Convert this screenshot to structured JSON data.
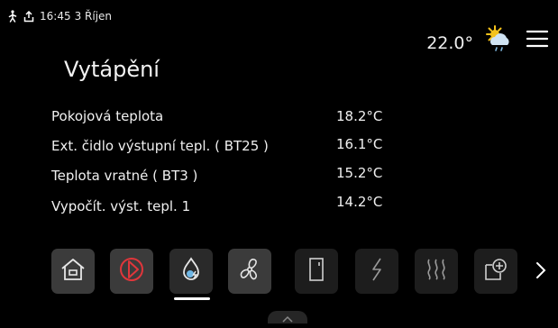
{
  "status": {
    "time": "16:45",
    "date": "3  Říjen"
  },
  "weather": {
    "temperature": "22.0°",
    "icon": "partly-sunny-rain-icon"
  },
  "page": {
    "title": "Vytápění"
  },
  "rows": [
    {
      "label": "Pokojová teplota",
      "value": "18.2°C"
    },
    {
      "label": "Ext. čidlo výstupní tepl. (  BT25 )",
      "value": "16.1°C"
    },
    {
      "label": "Teplota vratné ( BT3 )",
      "value": "15.2°C"
    },
    {
      "label": "Vypočít. výst. tepl. 1",
      "value": "14.2°C"
    }
  ],
  "nav": {
    "icons": [
      "home-icon",
      "play-icon",
      "water-drop-icon",
      "fan-icon",
      "door-icon",
      "lightning-icon",
      "heat-icon",
      "add-window-icon",
      "chevron-right-icon"
    ],
    "active_index": 2
  },
  "colors": {
    "accent": "#e0363b",
    "background": "#000000",
    "tile": "#3b3b3b"
  }
}
